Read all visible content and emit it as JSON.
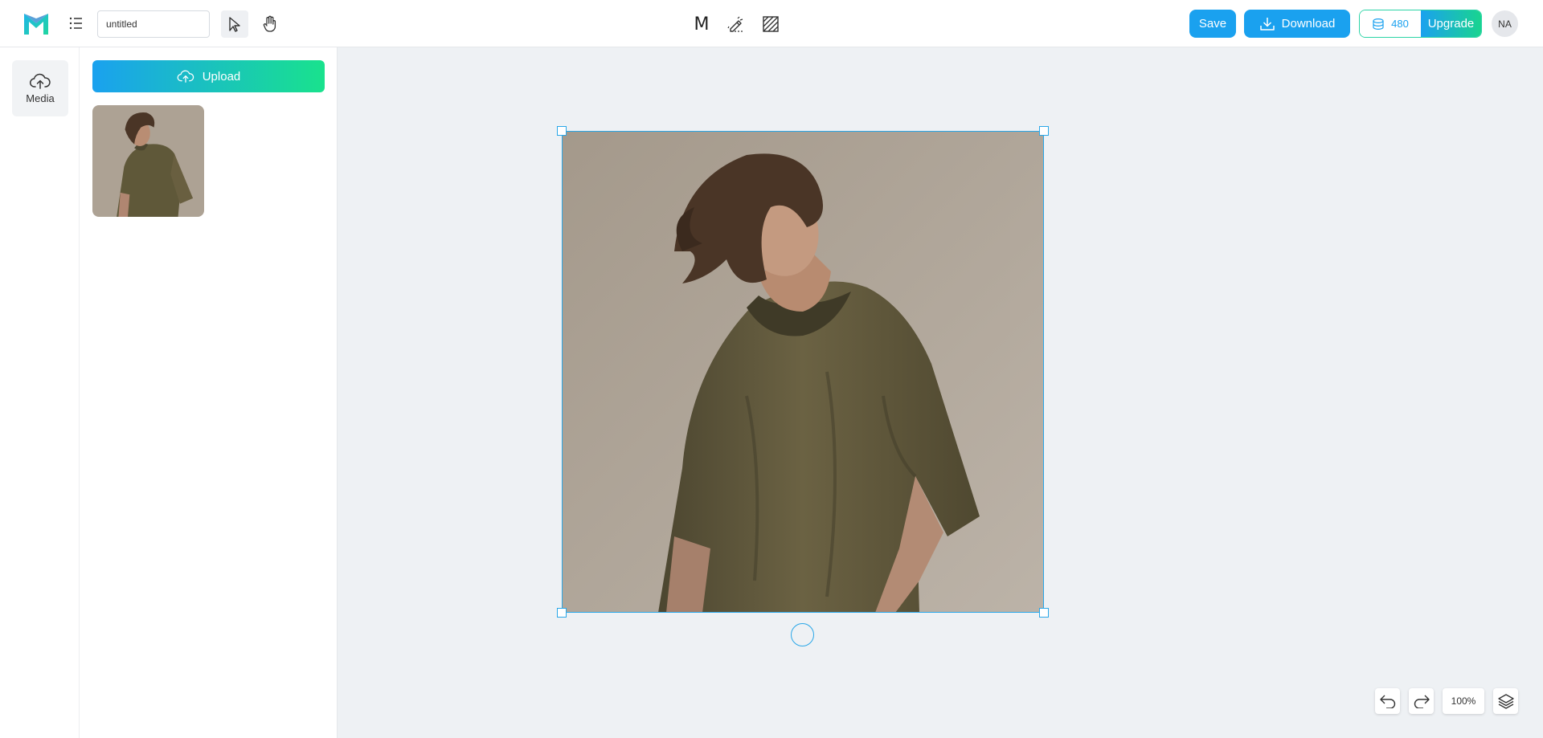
{
  "app": {
    "doc_name": "untitled"
  },
  "toolbar": {
    "mode_m_label": "M",
    "save_label": "Save",
    "download_label": "Download",
    "credits": "480",
    "upgrade_label": "Upgrade",
    "avatar_initials": "NA"
  },
  "rail": {
    "items": [
      {
        "label": "Media",
        "icon": "cloud-upload-icon"
      }
    ]
  },
  "panel": {
    "upload_label": "Upload"
  },
  "controls": {
    "zoom": "100%"
  },
  "colors": {
    "accent": "#1aa1ef",
    "gradient_end": "#19d48f",
    "selection": "#2aa7e8",
    "canvas_bg": "#eef1f4"
  }
}
